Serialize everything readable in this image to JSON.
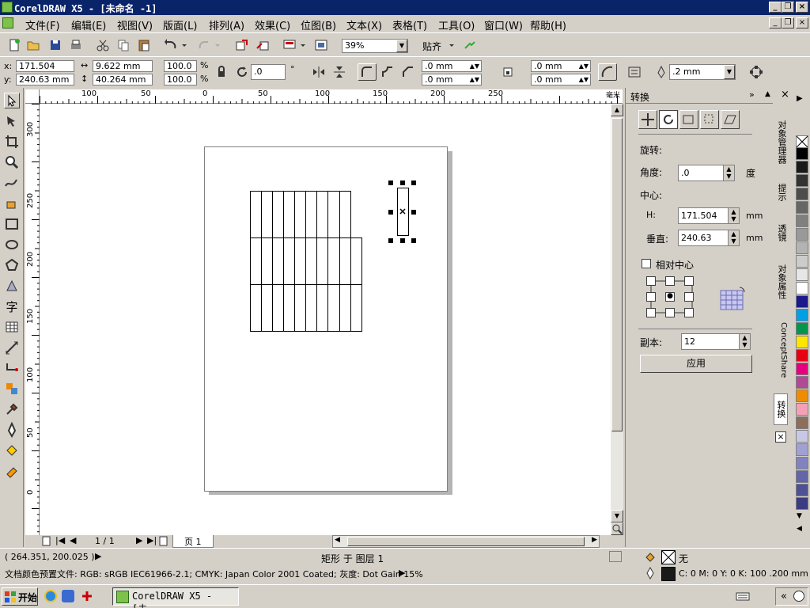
{
  "title_bar": {
    "title": "CorelDRAW X5 - [未命名 -1]"
  },
  "menu": [
    "文件(F)",
    "编辑(E)",
    "视图(V)",
    "版面(L)",
    "排列(A)",
    "效果(C)",
    "位图(B)",
    "文本(X)",
    "表格(T)",
    "工具(O)",
    "窗口(W)",
    "帮助(H)"
  ],
  "toolbar": {
    "zoom": "39%",
    "snap_label": "贴齐"
  },
  "property_bar": {
    "x_label": "x:",
    "x": "171.504 mm",
    "y_label": "y:",
    "y": "240.63 mm",
    "width": "9.622 mm",
    "height": "40.264 mm",
    "scale_x": "100.0",
    "scale_y": "100.0",
    "percent": "%",
    "angle": ".0",
    "degree": "°",
    "corner1": ".0 mm",
    "corner2": ".0 mm",
    "corner3": ".0 mm",
    "corner4": ".0 mm",
    "outline": ".2 mm"
  },
  "ruler": {
    "h_labels": [
      "100",
      "50",
      "0",
      "50",
      "100",
      "150",
      "200",
      "250"
    ],
    "v_labels": [
      "300",
      "250",
      "200",
      "150",
      "100",
      "50",
      "0"
    ],
    "h_unit": "毫米"
  },
  "page_nav": {
    "page_count": "1 / 1",
    "page_tab": "页 1"
  },
  "docker": {
    "title": "转换",
    "section": "旋转:",
    "angle_label": "角度:",
    "angle": ".0",
    "angle_unit": "度",
    "center_label": "中心:",
    "h_label": "H:",
    "h": "171.504",
    "h_unit": "mm",
    "v_label": "垂直:",
    "v": "240.63",
    "v_unit": "mm",
    "relative_center": "相对中心",
    "copies_label": "副本:",
    "copies": "12",
    "apply": "应用"
  },
  "side_tabs": [
    "对象管理器",
    "提示",
    "透镜",
    "对象属性",
    "ConceptShare",
    "转换"
  ],
  "palette": [
    "#ffffff",
    "#000000",
    "#1a1a1a",
    "#333333",
    "#4d4d4d",
    "#666666",
    "#808080",
    "#999999",
    "#b3b3b3",
    "#cccccc",
    "#e6e6e6",
    "#ffffff",
    "#1a1a8c",
    "#00a0e6",
    "#00964b",
    "#ffe600",
    "#e60012",
    "#e6007e",
    "#b04a94",
    "#f08c00",
    "#f5a0b4",
    "#8c6e5a",
    "#c8c8e6",
    "#a0a0d2",
    "#8282be",
    "#6464aa",
    "#505096",
    "#3c3c82"
  ],
  "status": {
    "coords": "( 264.351, 200.025 )",
    "object_info": "矩形 于 图层 1",
    "fill_none": "无",
    "doc_profile": "文档颜色预置文件: RGB: sRGB IEC61966-2.1; CMYK: Japan Color 2001 Coated; 灰度: Dot Gain 15%",
    "outline_info": "C: 0 M: 0 Y: 0 K: 100  .200 mm"
  },
  "taskbar": {
    "start": "开始",
    "task": "CorelDRAW X5 - [未..."
  }
}
